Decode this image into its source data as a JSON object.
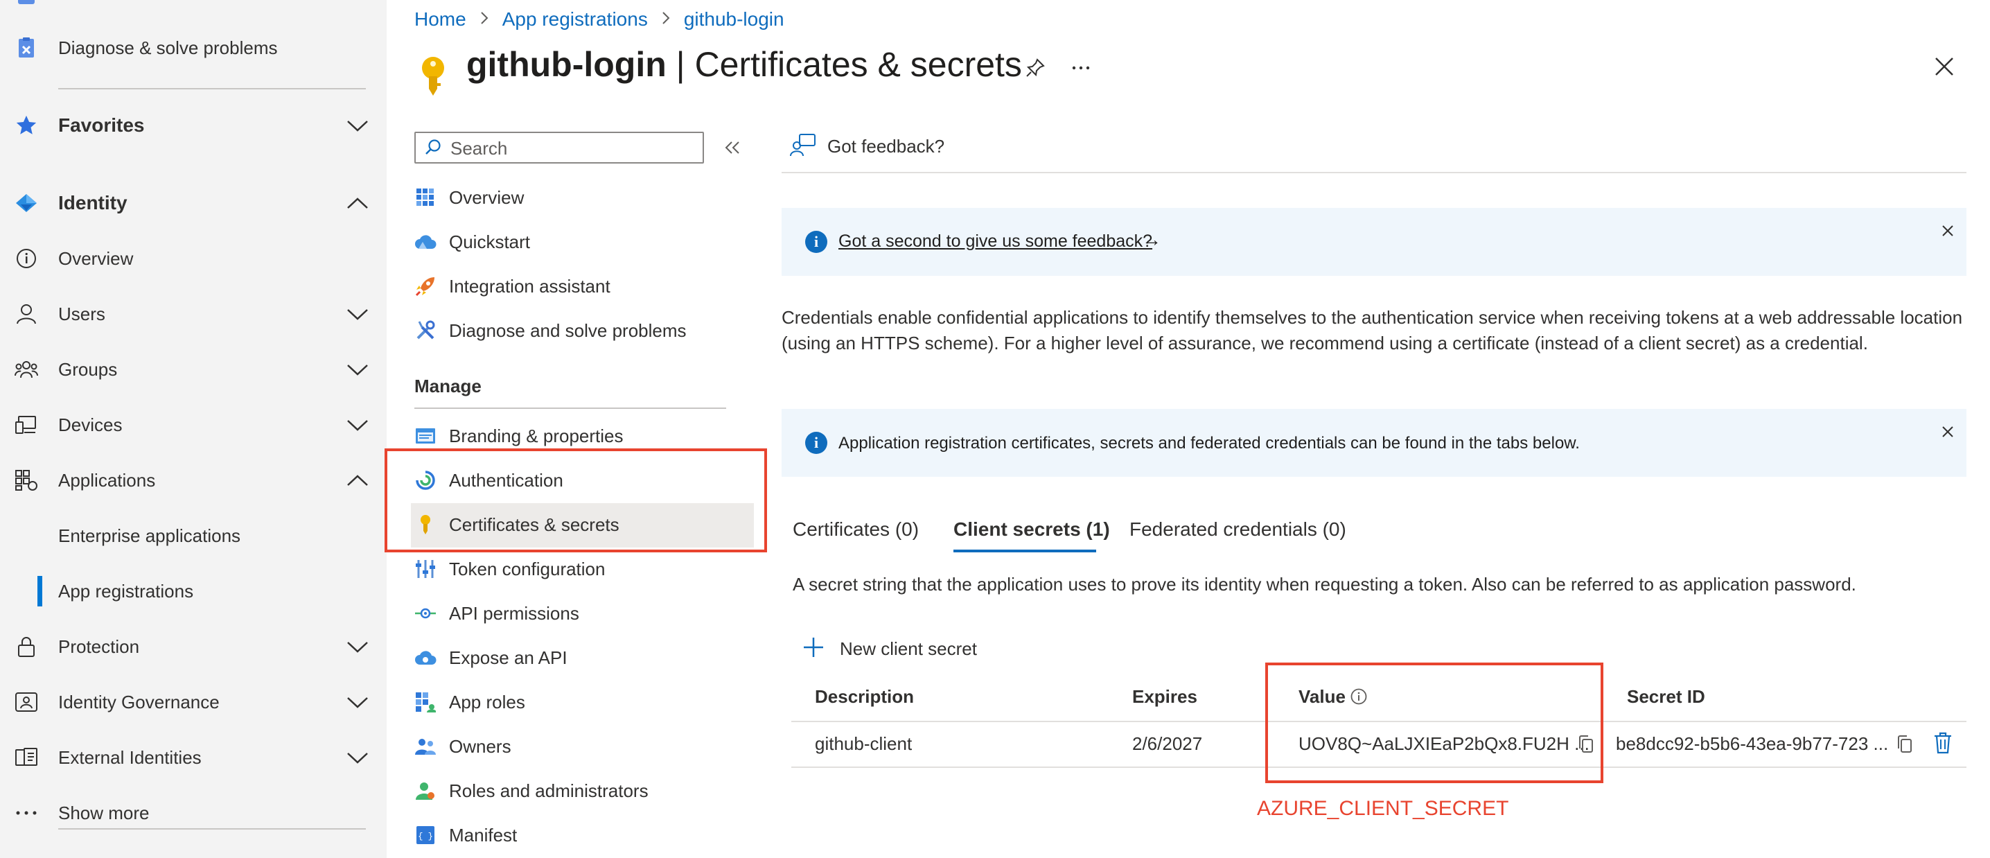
{
  "left_nav": {
    "items": [
      {
        "label": "Diagnose & solve problems"
      },
      {
        "label": "Favorites"
      },
      {
        "label": "Identity"
      },
      {
        "label": "Overview"
      },
      {
        "label": "Users"
      },
      {
        "label": "Groups"
      },
      {
        "label": "Devices"
      },
      {
        "label": "Applications"
      },
      {
        "label": "Enterprise applications"
      },
      {
        "label": "App registrations"
      },
      {
        "label": "Protection"
      },
      {
        "label": "Identity Governance"
      },
      {
        "label": "External Identities"
      },
      {
        "label": "Show more"
      }
    ]
  },
  "breadcrumb": [
    "Home",
    "App registrations",
    "github-login"
  ],
  "header": {
    "app_name": "github-login",
    "separator": " | ",
    "page_name": "Certificates & secrets"
  },
  "resource_menu": {
    "search_placeholder": "Search",
    "items": [
      {
        "label": "Overview"
      },
      {
        "label": "Quickstart"
      },
      {
        "label": "Integration assistant"
      },
      {
        "label": "Diagnose and solve problems"
      }
    ],
    "manage_heading": "Manage",
    "manage_items": [
      {
        "label": "Branding & properties"
      },
      {
        "label": "Authentication"
      },
      {
        "label": "Certificates & secrets"
      },
      {
        "label": "Token configuration"
      },
      {
        "label": "API permissions"
      },
      {
        "label": "Expose an API"
      },
      {
        "label": "App roles"
      },
      {
        "label": "Owners"
      },
      {
        "label": "Roles and administrators"
      },
      {
        "label": "Manifest"
      }
    ]
  },
  "toolbar": {
    "feedback_label": "Got feedback?"
  },
  "feedback_banner": {
    "link_text": "Got a second to give us some feedback?",
    "arrow": "→"
  },
  "description": {
    "line1": "Credentials enable confidential applications to identify themselves to the authentication service when receiving tokens at a web addressable location",
    "line2": "(using an HTTPS scheme). For a higher level of assurance, we recommend using a certificate (instead of a client secret) as a credential."
  },
  "info_banner": {
    "text": "Application registration certificates, secrets and federated credentials can be found in the tabs below."
  },
  "tabs": [
    {
      "label": "Certificates (0)"
    },
    {
      "label": "Client secrets (1)"
    },
    {
      "label": "Federated credentials (0)"
    }
  ],
  "tab_description": "A secret string that the application uses to prove its identity when requesting a token. Also can be referred to as application password.",
  "new_secret_label": "New client secret",
  "secrets_table": {
    "headers": {
      "description": "Description",
      "expires": "Expires",
      "value": "Value",
      "secret_id": "Secret ID"
    },
    "rows": [
      {
        "description": "github-client",
        "expires": "2/6/2027",
        "value": "UOV8Q~AaLJXIEaP2bQx8.FU2H ...",
        "secret_id": "be8dcc92-b5b6-43ea-9b77-723 ..."
      }
    ]
  },
  "annotation_label": "AZURE_CLIENT_SECRET",
  "colors": {
    "accent": "#0f6cbd",
    "highlight": "#e8442f",
    "nav_bg": "#f3f3f3",
    "banner_bg": "#eff6fc"
  }
}
